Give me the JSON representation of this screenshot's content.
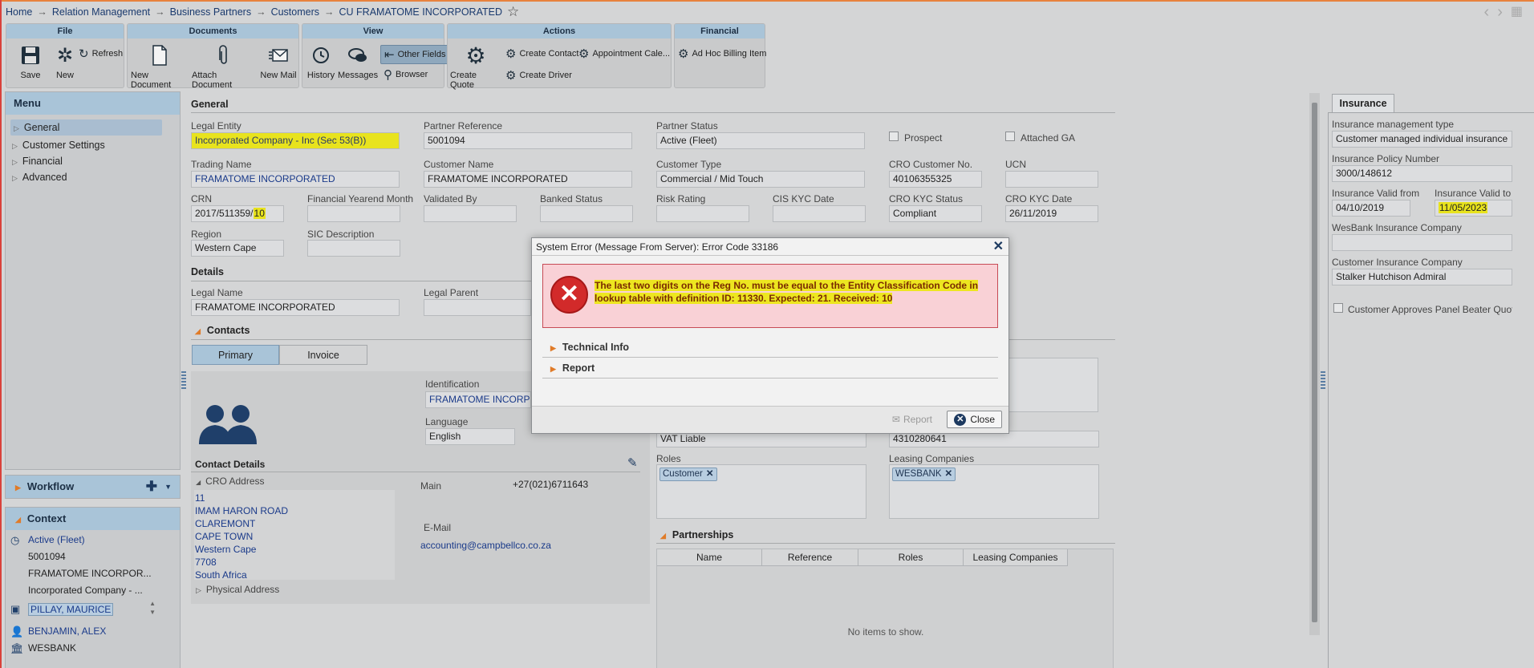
{
  "breadcrumb": [
    "Home",
    "Relation Management",
    "Business Partners",
    "Customers",
    "CU FRAMATOME INCORPORATED"
  ],
  "breadcrumb_sep": "→",
  "ribbon": {
    "file": {
      "title": "File",
      "save": "Save",
      "new": "New",
      "refresh": "Refresh"
    },
    "documents": {
      "title": "Documents",
      "new_document": "New Document",
      "attach_document": "Attach Document",
      "new_mail": "New Mail"
    },
    "view": {
      "title": "View",
      "history": "History",
      "messages": "Messages",
      "other_fields": "Other Fields",
      "browser": "Browser"
    },
    "actions": {
      "title": "Actions",
      "create_quote": "Create Quote",
      "create_contact": "Create Contact",
      "appointment": "Appointment Cale...",
      "create_driver": "Create Driver"
    },
    "financial": {
      "title": "Financial",
      "ad_hoc": "Ad Hoc Billing Item"
    }
  },
  "menu": {
    "title": "Menu",
    "items": [
      "General",
      "Customer Settings",
      "Financial",
      "Advanced"
    ]
  },
  "workflow": {
    "title": "Workflow"
  },
  "context": {
    "title": "Context",
    "items": [
      "Active (Fleet)",
      "5001094",
      "FRAMATOME INCORPOR...",
      "Incorporated Company - ...",
      "PILLAY, MAURICE",
      "BENJAMIN, ALEX",
      "WESBANK"
    ]
  },
  "general": {
    "title": "General",
    "legal_entity_label": "Legal Entity",
    "legal_entity": "Incorporated Company - Inc (Sec 53(B))",
    "partner_ref_label": "Partner Reference",
    "partner_ref": "5001094",
    "partner_status_label": "Partner Status",
    "partner_status": "Active (Fleet)",
    "prospect_label": "Prospect",
    "attached_ga_label": "Attached GA",
    "trading_name_label": "Trading Name",
    "trading_name": "FRAMATOME INCORPORATED",
    "customer_name_label": "Customer Name",
    "customer_name": "FRAMATOME INCORPORATED",
    "customer_type_label": "Customer Type",
    "customer_type": "Commercial / Mid Touch",
    "cro_no_label": "CRO Customer No.",
    "cro_no": "40106355325",
    "ucn_label": "UCN",
    "crn_label": "CRN",
    "crn_prefix": "2017/511359/",
    "crn_suffix": "10",
    "fin_year_label": "Financial Yearend Month",
    "validated_label": "Validated By",
    "banked_label": "Banked Status",
    "risk_label": "Risk Rating",
    "cis_label": "CIS KYC Date",
    "cro_kyc_status_label": "CRO KYC Status",
    "cro_kyc_status": "Compliant",
    "cro_kyc_date_label": "CRO KYC Date",
    "cro_kyc_date": "26/11/2019",
    "region_label": "Region",
    "region": "Western Cape",
    "sic_label": "SIC Description"
  },
  "details": {
    "title": "Details",
    "legal_name_label": "Legal Name",
    "legal_name": "FRAMATOME INCORPORATED",
    "legal_parent_label": "Legal Parent"
  },
  "contacts": {
    "title": "Contacts",
    "tab_primary": "Primary",
    "tab_invoice": "Invoice",
    "identification_label": "Identification",
    "identification": "FRAMATOME INCORPORATED",
    "language_label": "Language",
    "language": "English",
    "contact_details": "Contact Details",
    "cro_address": "CRO Address",
    "address_lines": [
      "11",
      "IMAM HARON ROAD",
      "CLAREMONT",
      "CAPE TOWN",
      "Western Cape",
      "7708",
      "South Africa"
    ],
    "physical_address": "Physical Address",
    "main_label": "Main",
    "main": "+27(021)6711643",
    "email_label": "E-Mail",
    "email": "accounting@campbellco.co.za"
  },
  "right_form": {
    "vat": "VAT Liable",
    "vat_no": "4310280641",
    "roles_label": "Roles",
    "roles_tag": "Customer",
    "leasing_label": "Leasing Companies",
    "leasing_tag": "WESBANK",
    "partnerships_title": "Partnerships",
    "partnership_cols": [
      "Name",
      "Reference",
      "Roles",
      "Leasing Companies"
    ],
    "no_items": "No items to show."
  },
  "insurance": {
    "tab": "Insurance",
    "mgmt_type_label": "Insurance management type",
    "mgmt_type": "Customer managed individual insurance",
    "policy_label": "Insurance Policy Number",
    "policy": "3000/148612",
    "valid_from_label": "Insurance Valid from",
    "valid_from": "04/10/2019",
    "valid_to_label": "Insurance Valid to",
    "valid_to": "11/05/2023",
    "wesbank_co_label": "WesBank Insurance Company",
    "cust_co_label": "Customer Insurance Company",
    "cust_co": "Stalker Hutchison Admiral",
    "panel_beater": "Customer Approves Panel Beater Quote"
  },
  "dialog": {
    "title": "System Error (Message From Server): Error Code 33186",
    "message": "The last two digits on the Reg No. must be equal to the Entity Classification Code in lookup table with definition ID: 11330. Expected: 21. Received: 10",
    "technical_info": "Technical Info",
    "report_section": "Report",
    "report_button": "Report",
    "close_button": "Close"
  }
}
